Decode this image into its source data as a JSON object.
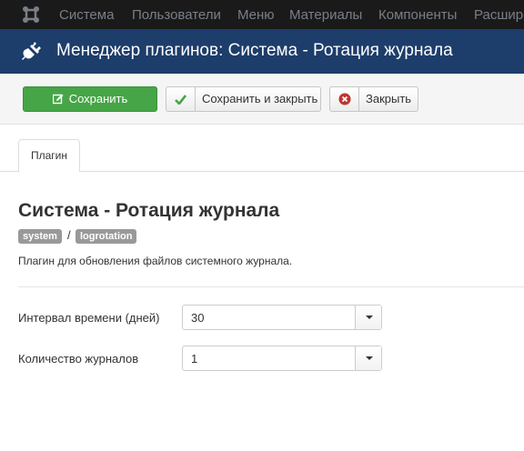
{
  "navbar": {
    "items": [
      "Система",
      "Пользователи",
      "Меню",
      "Материалы",
      "Компоненты",
      "Расширения"
    ]
  },
  "header": {
    "title": "Менеджер плагинов: Система - Ротация журнала"
  },
  "toolbar": {
    "save_label": "Сохранить",
    "save_close_label": "Сохранить и закрыть",
    "close_label": "Закрыть"
  },
  "tabs": [
    {
      "label": "Плагин",
      "active": true
    }
  ],
  "plugin": {
    "name": "Система - Ротация журнала",
    "badges": [
      "system",
      "logrotation"
    ],
    "badge_separator": "/",
    "description": "Плагин для обновления файлов системного журнала."
  },
  "fields": [
    {
      "label": "Интервал времени (дней)",
      "value": "30"
    },
    {
      "label": "Количество журналов",
      "value": "1"
    }
  ],
  "colors": {
    "navbar": "#1a1a1a",
    "header": "#1d3d6b",
    "save_button": "#46a546",
    "badge": "#999999"
  }
}
